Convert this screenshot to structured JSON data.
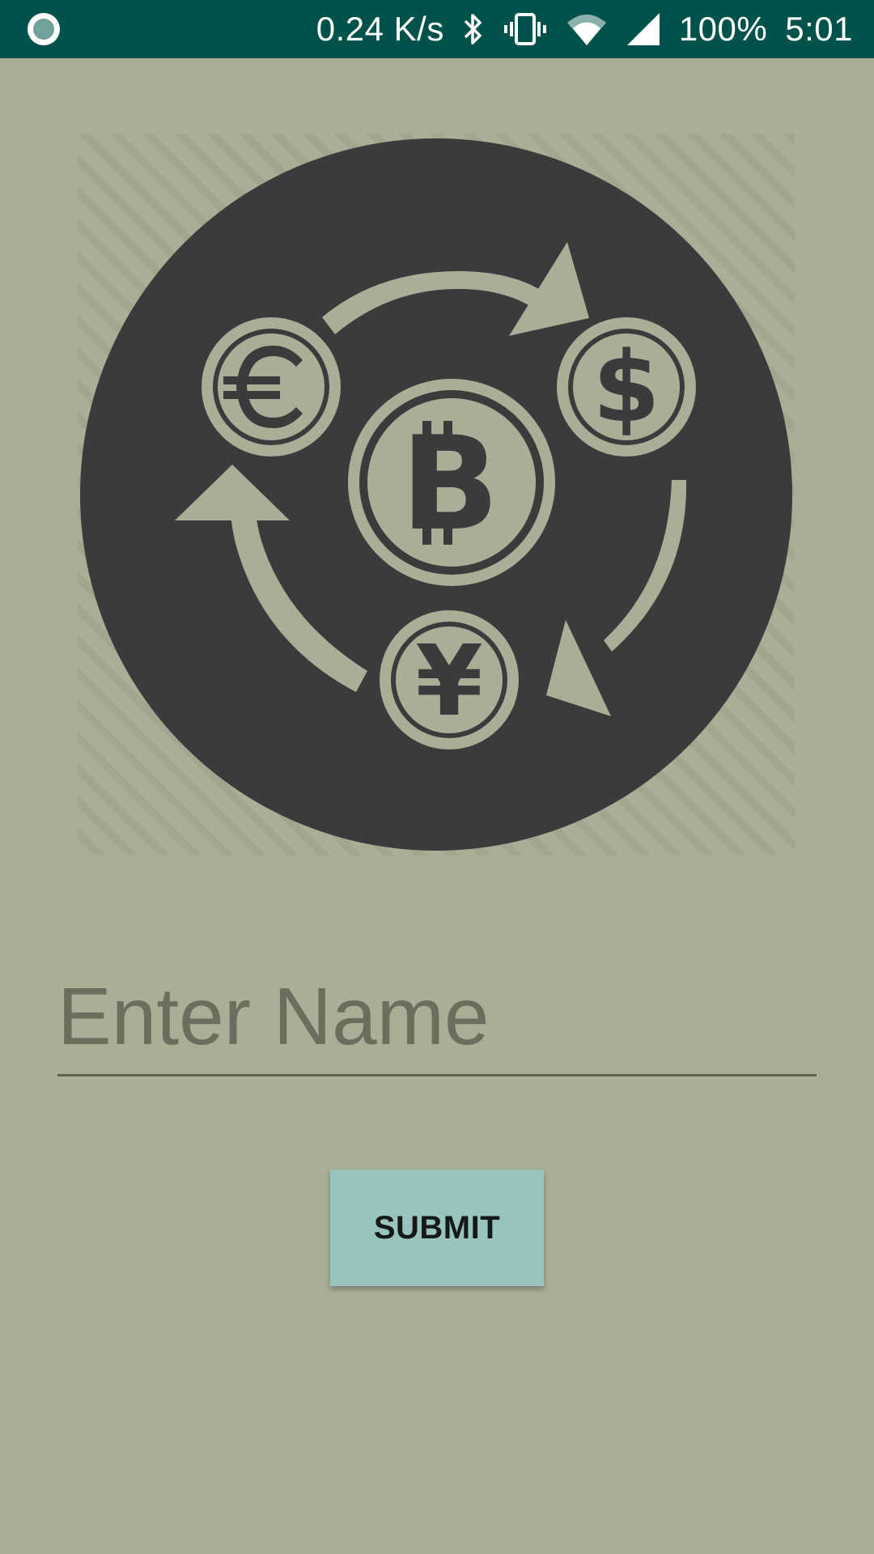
{
  "status_bar": {
    "network_speed": "0.24 K/s",
    "battery": "100%",
    "time": "5:01",
    "icons": [
      "app-notification-icon",
      "bluetooth-icon",
      "vibrate-icon",
      "wifi-icon",
      "cell-signal-icon"
    ]
  },
  "logo": {
    "icons": [
      "euro-coin-icon",
      "dollar-coin-icon",
      "bitcoin-coin-icon",
      "yen-coin-icon",
      "exchange-arrows-icon"
    ],
    "colors": {
      "circle": "#3b3b3b",
      "foreground": "#a9ae96"
    }
  },
  "form": {
    "name_placeholder": "Enter Name",
    "name_value": "",
    "submit_label": "SUBMIT"
  },
  "colors": {
    "background": "#a9ae96",
    "status_bar": "#00524a",
    "button": "#99c4bd"
  }
}
